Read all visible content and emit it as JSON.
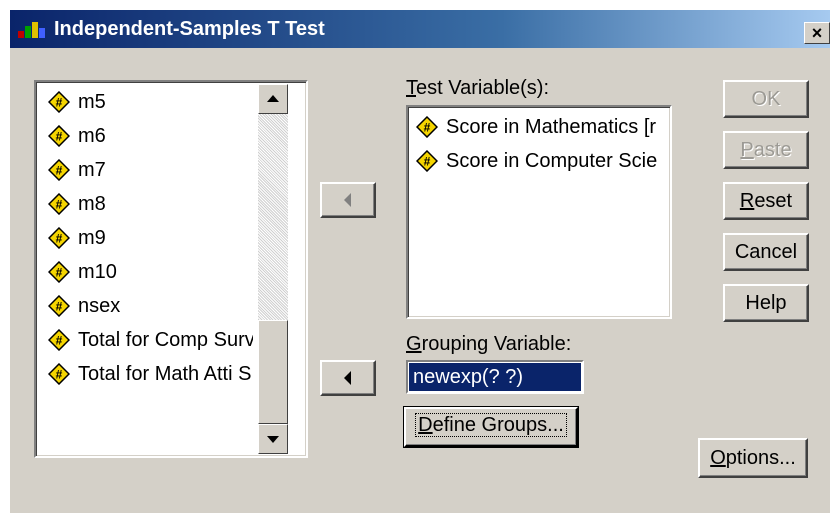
{
  "window": {
    "title": "Independent-Samples T Test",
    "close_label": "×"
  },
  "variable_list": {
    "items": [
      "m5",
      "m6",
      "m7",
      "m8",
      "m9",
      "m10",
      "nsex",
      "Total for Comp Surv",
      "Total for Math Atti S"
    ]
  },
  "test_variables": {
    "label_first": "T",
    "label_rest": "est Variable(s):",
    "items": [
      "Score in Mathematics [r",
      "Score in Computer Scie"
    ]
  },
  "grouping": {
    "label_first": "G",
    "label_rest": "rouping Variable:",
    "value": "newexp(? ?)"
  },
  "buttons": {
    "ok": "OK",
    "paste_first": "P",
    "paste_rest": "aste",
    "reset_first": "R",
    "reset_rest": "eset",
    "cancel": "Cancel",
    "help": "Help",
    "define_first": "D",
    "define_rest": "efine Groups...",
    "options_first": "O",
    "options_rest": "ptions..."
  },
  "colors": {
    "title_bar": "#0a246a",
    "dialog_bg": "#d4d0c8",
    "selection": "#0a246a",
    "var_icon": "#f5d500"
  }
}
